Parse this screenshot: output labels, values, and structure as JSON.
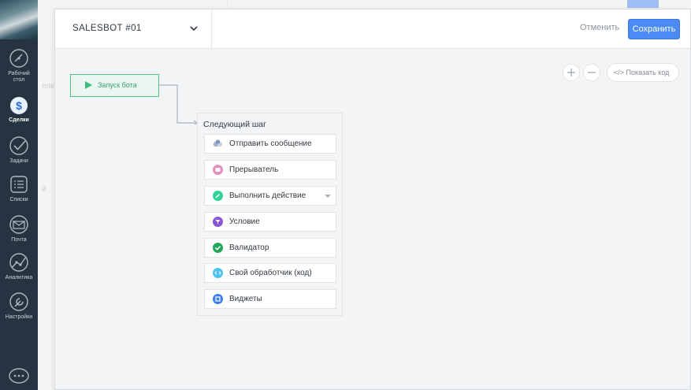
{
  "nav": {
    "items": [
      {
        "label": "Рабочий стол",
        "line1": "Рабочий",
        "line2": "стол"
      },
      {
        "label": "Сделки"
      },
      {
        "label": "Задачи"
      },
      {
        "label": "Списки"
      },
      {
        "label": "Почта"
      },
      {
        "label": "Аналитика"
      },
      {
        "label": "Настройки"
      }
    ]
  },
  "background": {
    "fragment1": "елки",
    "fragment2": "й"
  },
  "modal": {
    "title": "SALESBOT #01",
    "cancel_label": "Отменить",
    "save_label": "Сохранить",
    "show_code_label": "Показать код",
    "show_code_icon": "</>",
    "start_node_label": "Запуск бота",
    "next_step": {
      "title": "Следующий шаг",
      "options": [
        {
          "label": "Отправить сообщение",
          "icon": "message-icon",
          "color": "#c5d3e6"
        },
        {
          "label": "Прерыватель",
          "icon": "interrupt-icon",
          "color": "#e58ec2"
        },
        {
          "label": "Выполнить действие",
          "icon": "pencil-icon",
          "color": "#2fd397"
        },
        {
          "label": "Условие",
          "icon": "filter-icon",
          "color": "#8a56d6"
        },
        {
          "label": "Валидатор",
          "icon": "check-icon",
          "color": "#23a55a"
        },
        {
          "label": "Свой обработчик (код)",
          "icon": "code-icon",
          "color": "#4cc3ee"
        },
        {
          "label": "Виджеты",
          "icon": "widgets-icon",
          "color": "#3f7ee8"
        }
      ]
    }
  },
  "colors": {
    "accent": "#4c8bf5",
    "start_green": "#4fc08d",
    "nav_bg": "#263340"
  }
}
